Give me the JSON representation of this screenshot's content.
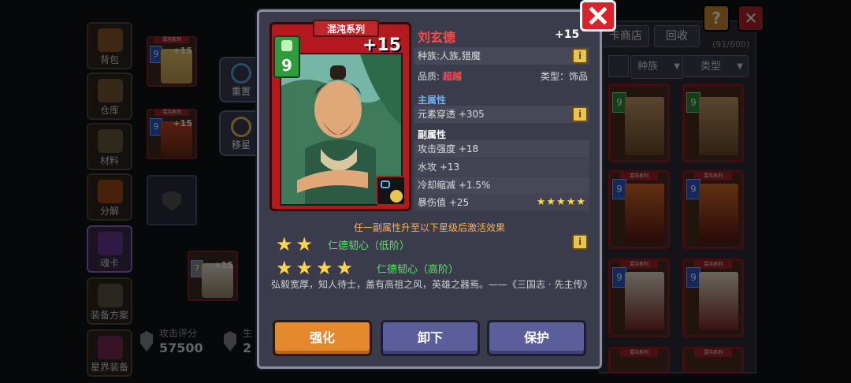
{
  "sidebar": {
    "items": [
      {
        "label": "背包",
        "icon": "backpack-icon"
      },
      {
        "label": "仓库",
        "icon": "storage-icon"
      },
      {
        "label": "材料",
        "icon": "materials-icon"
      },
      {
        "label": "分解",
        "icon": "decompose-icon"
      },
      {
        "label": "魂卡",
        "icon": "soul-card-icon"
      },
      {
        "label": "装备方案",
        "icon": "equipment-plan-icon"
      },
      {
        "label": "星界装备",
        "icon": "astral-equipment-icon"
      }
    ]
  },
  "left_cards": [
    {
      "series": "混沌系列",
      "level": "9",
      "plus": "+15"
    },
    {
      "series": "混沌系列",
      "level": "9",
      "plus": "+15"
    },
    {
      "series": "",
      "level": "7",
      "plus": "+15"
    }
  ],
  "functions": {
    "reset": "重置",
    "move_star": "移星"
  },
  "score": {
    "label": "攻击评分",
    "value": "57500",
    "label2": "生",
    "value2": "2"
  },
  "right_panel": {
    "tab_shop": "卡商店",
    "tab_recycle": "回收",
    "count": "(91/600)",
    "filter_race": "种族",
    "filter_type": "类型",
    "card_series": "混沌系列",
    "card_level": "9"
  },
  "corner": {
    "help": "?",
    "close": "✕"
  },
  "modal": {
    "card": {
      "series": "混沌系列",
      "cost": "9",
      "plus": "+15"
    },
    "name": "刘玄德",
    "level": "+15",
    "race": "种族:人族,猎魔",
    "quality_label": "品质:",
    "quality_value": "超越",
    "type": "类型：饰品",
    "main_attr_title": "主属性",
    "main_attr": "元素穿透 +305",
    "sub_attr_title": "副属性",
    "sub_attrs": [
      "攻击强度 +18",
      "水攻 +13",
      "冷却缩减 +1.5%",
      "暴伤值 +25"
    ],
    "sub_attr_stars": 5,
    "activate_text": "任一副属性升至以下星级后激活效果",
    "set_low": {
      "stars": 2,
      "label": "仁德韧心（低阶）"
    },
    "set_high": {
      "stars": 4,
      "label": "仁德韧心（高阶）"
    },
    "quote": "弘毅宽厚，知人待士，盖有高祖之风，英雄之器焉。——《三国志 · 先主传》",
    "buttons": {
      "enhance": "强化",
      "unequip": "卸下",
      "protect": "保护"
    }
  },
  "colors": {
    "accent_red": "#d8232a",
    "name_red": "#ff4a4a",
    "set_green": "#5fe06a",
    "activate_orange": "#ffb347",
    "button_orange": "#e38a2e",
    "button_purple": "#5c5e9c",
    "star_gold": "#ffd54a"
  }
}
